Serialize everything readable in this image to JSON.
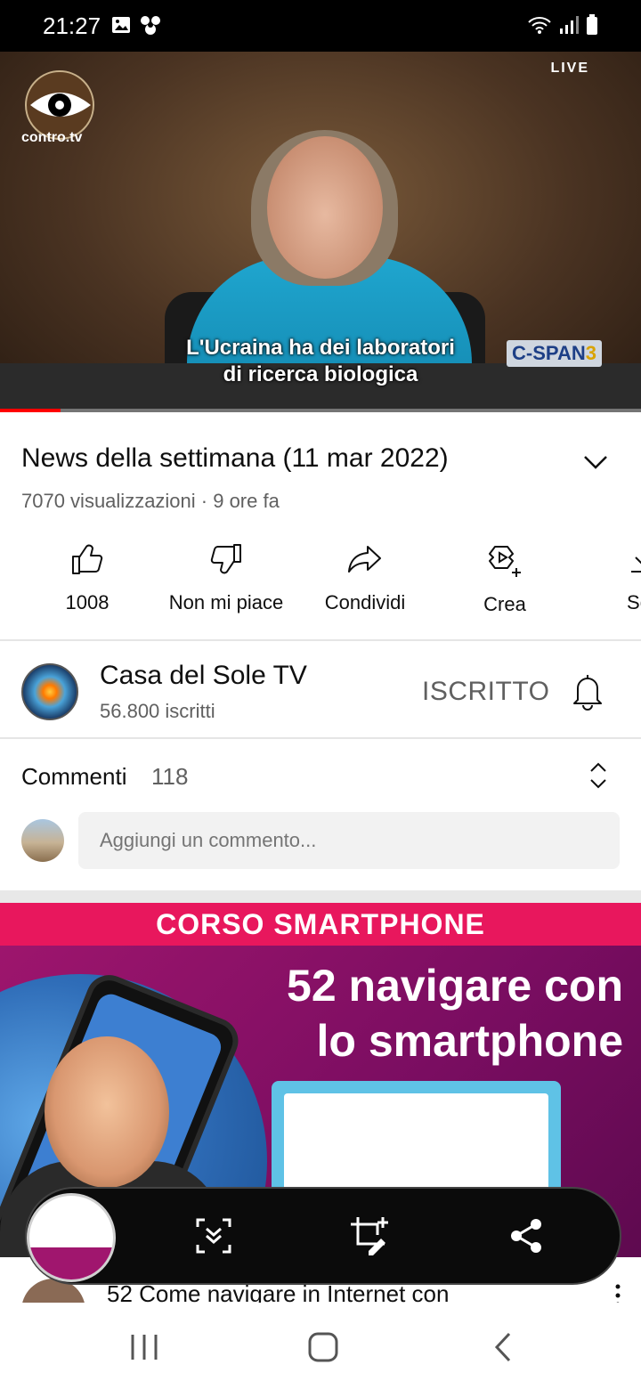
{
  "status_bar": {
    "time": "21:27"
  },
  "player": {
    "channel_logo_text": "contro.tv",
    "live_label": "LIVE",
    "subtitle_line1": "L'Ucraina ha dei laboratori",
    "subtitle_line2": "di ricerca biologica",
    "broadcaster_prefix": "C-SPAN",
    "broadcaster_suffix": "3",
    "progress_fraction": 0.095,
    "progress_color": "#ff0000"
  },
  "video": {
    "title": "News della settimana (11 mar 2022)",
    "meta": "7070 visualizzazioni · 9 ore fa"
  },
  "actions": [
    {
      "label": "1008",
      "icon": "thumb-up-icon"
    },
    {
      "label": "Non mi piace",
      "icon": "thumb-down-icon"
    },
    {
      "label": "Condividi",
      "icon": "share-icon"
    },
    {
      "label": "Crea",
      "icon": "create-icon"
    },
    {
      "label": "Sca",
      "icon": "download-icon"
    }
  ],
  "channel": {
    "name": "Casa del Sole TV",
    "subscribers": "56.800 iscritti",
    "subscribe_state": "ISCRITTO"
  },
  "comments": {
    "label": "Commenti",
    "count": "118",
    "placeholder": "Aggiungi un commento..."
  },
  "next_video": {
    "thumbnail_banner": "CORSO SMARTPHONE",
    "thumbnail_line1": "52 navigare con",
    "thumbnail_line2": "lo smartphone",
    "title": "52 Come navigare in Internet con"
  },
  "accent_color": "#ff0000"
}
